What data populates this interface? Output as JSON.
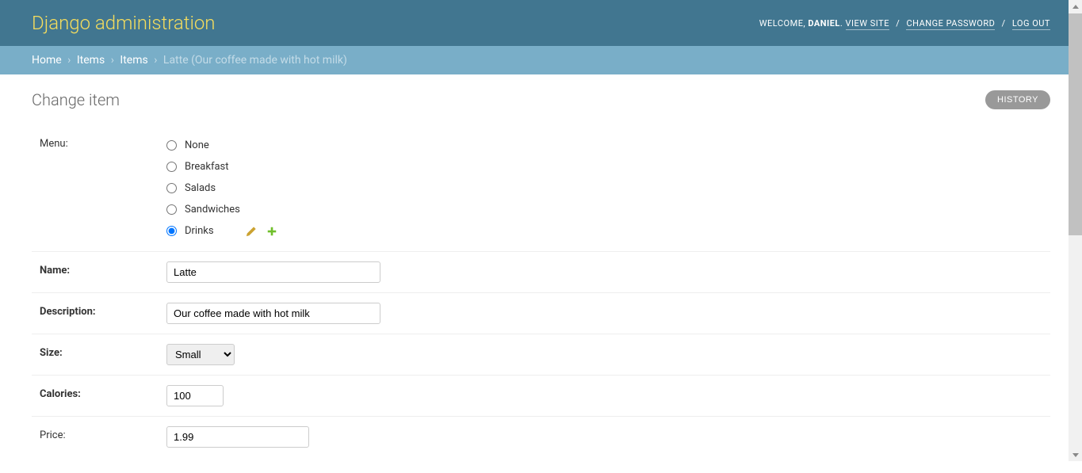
{
  "header": {
    "branding": "Django administration",
    "welcome_text": "WELCOME, ",
    "username": "DANIEL",
    "view_site": "VIEW SITE",
    "change_password": "CHANGE PASSWORD",
    "log_out": "LOG OUT"
  },
  "breadcrumbs": {
    "home": "Home",
    "app": "Items",
    "model": "Items",
    "current": "Latte (Our coffee made with hot milk)"
  },
  "page": {
    "title": "Change item",
    "history_btn": "HISTORY"
  },
  "form": {
    "menu": {
      "label": "Menu:",
      "options": {
        "none": "None",
        "breakfast": "Breakfast",
        "salads": "Salads",
        "sandwiches": "Sandwiches",
        "drinks": "Drinks"
      },
      "selected": "drinks"
    },
    "name": {
      "label": "Name:",
      "value": "Latte"
    },
    "description": {
      "label": "Description:",
      "value": "Our coffee made with hot milk"
    },
    "size": {
      "label": "Size:",
      "value": "Small"
    },
    "calories": {
      "label": "Calories:",
      "value": "100"
    },
    "price": {
      "label": "Price:",
      "value": "1.99"
    }
  }
}
